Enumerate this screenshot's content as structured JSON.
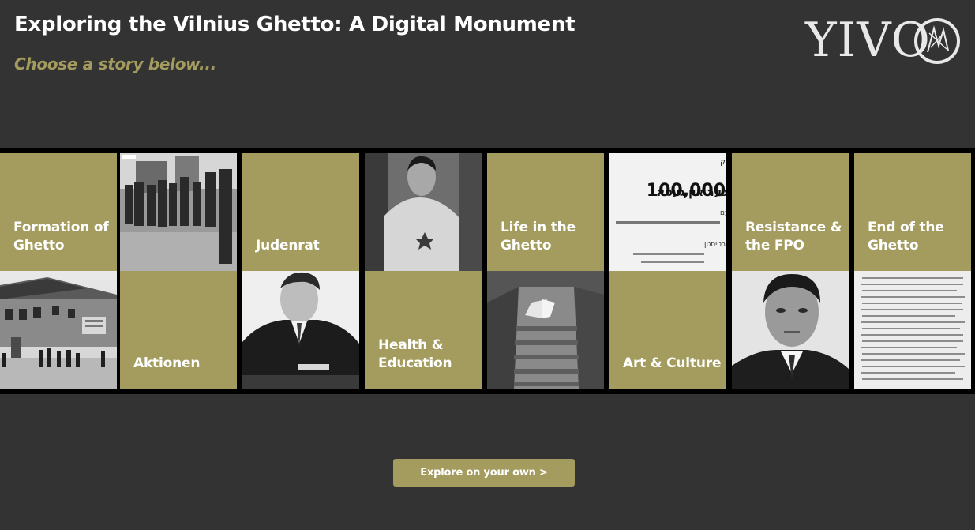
{
  "header": {
    "title": "Exploring the Vilnius Ghetto: A Digital Monument",
    "subtitle": "Choose a story below..."
  },
  "logo": {
    "text": "YIVO",
    "icon": "yivo-emblem-icon"
  },
  "stories": [
    {
      "label": "Formation of Ghetto",
      "label_position": "top",
      "photo": "ghetto-street-buildings-photo"
    },
    {
      "label": "Aktionen",
      "label_position": "bottom",
      "photo": "crowd-street-photo"
    },
    {
      "label": "Judenrat",
      "label_position": "top",
      "photo": "man-writing-portrait-photo"
    },
    {
      "label": "Health & Education",
      "label_position": "bottom",
      "photo": "seated-boy-star-photo"
    },
    {
      "label": "Life in the Ghetto",
      "label_position": "top",
      "photo": "stairway-photo"
    },
    {
      "label": "Art & Culture",
      "label_position": "bottom",
      "photo": "yiddish-poster-photo"
    },
    {
      "label": "Resistance & the FPO",
      "label_position": "top",
      "photo": "young-man-portrait-photo"
    },
    {
      "label": "End of the Ghetto",
      "label_position": "top",
      "photo": "typed-document-photo"
    }
  ],
  "poster_text": {
    "headline": "100,000",
    "line1": "געטא - ביבליאטעק",
    "line2": "ביכער אין געטא",
    "line3": "פייערונג לכבוד דעם",
    "line4": "מיטן אנזיכט פון ארטיסטן"
  },
  "explore_button": {
    "label": "Explore on your own >"
  },
  "colors": {
    "background": "#333333",
    "accent": "#a39c5e",
    "strip": "#000000",
    "text": "#ffffff"
  }
}
